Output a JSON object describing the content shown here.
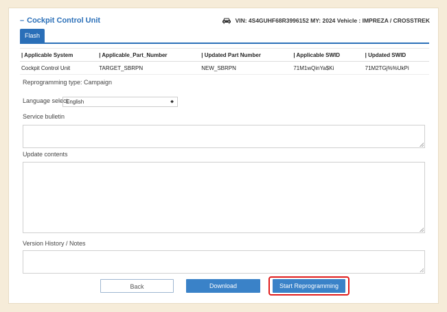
{
  "header": {
    "title": "Cockpit Control Unit",
    "vehicle_text": "VIN: 4S4GUHF68R3996152  MY: 2024  Vehicle : IMPREZA / CROSSTREK"
  },
  "tabs": [
    {
      "label": "Flash"
    }
  ],
  "table": {
    "headers": [
      "| Applicable System",
      "| Applicable_Part_Number",
      "| Updated Part Number",
      "| Applicable SWID",
      "| Updated SWID"
    ],
    "rows": [
      [
        "Cockpit Control Unit",
        "TARGET_SBRPN",
        "NEW_SBRPN",
        "71M1wQinYa$Ki",
        "71M2TGj%%UkPi"
      ]
    ]
  },
  "reprogramming_type": "Reprogramming type: Campaign",
  "language": {
    "label": "Language select:",
    "value": "English"
  },
  "sections": {
    "service_bulletin": "Service bulletin",
    "update_contents": "Update contents",
    "version_history": "Version History / Notes"
  },
  "buttons": {
    "back": "Back",
    "download": "Download",
    "start": "Start Reprogramming"
  },
  "colors": {
    "accent": "#2a6fb8",
    "highlight": "#e01a1a",
    "background": "#f6ecd9"
  }
}
